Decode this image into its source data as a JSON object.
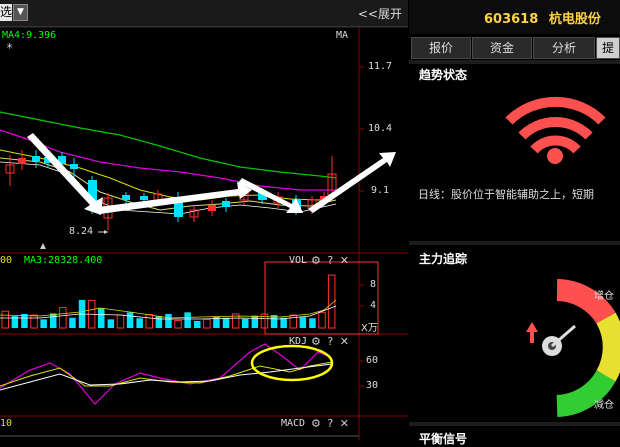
{
  "toolbar": {
    "select_label": "选",
    "expand_label": "<<展开"
  },
  "main_chart": {
    "indicator_name": "MA",
    "ma4_label": "MA4:9.396",
    "star": "*",
    "price_ticks": [
      "11.7",
      "10.4",
      "9.1"
    ],
    "low_price_label": "8.24",
    "colors": {
      "ma_yellow": "#e0e000",
      "ma_magenta": "#e000e0",
      "ma_green": "#00c800",
      "up": "#ff3030",
      "down": "#00e0ff"
    }
  },
  "volume_chart": {
    "left_fragment": "00",
    "ma3_label": "MA3:28328.400",
    "indicator_name": "VOL",
    "ticks": [
      "8",
      "4"
    ],
    "unit": "X万",
    "values": [
      3.1,
      2.2,
      2.6,
      2.4,
      1.6,
      2.7,
      3.8,
      1.9,
      5.2,
      5.1,
      3.6,
      1.6,
      2.4,
      2.9,
      1.8,
      2.5,
      2.2,
      2.6,
      1.4,
      2.9,
      1.3,
      1.6,
      2.1,
      1.9,
      2.6,
      1.7,
      2.3,
      2.6,
      2.4,
      1.9,
      2.4,
      2.0,
      1.8,
      2.9,
      9.8
    ]
  },
  "kdj_chart": {
    "indicator_name": "KDJ",
    "ticks": [
      "60",
      "30"
    ]
  },
  "macd_chart": {
    "left_fragment": "10",
    "indicator_name": "MACD"
  },
  "panel_icons": [
    "gear-icon",
    "question-icon",
    "close-icon"
  ],
  "sidebar": {
    "code": "603618",
    "name": "杭电股份",
    "tabs": [
      "报价",
      "资金",
      "分析",
      "提"
    ],
    "active_tab": 3,
    "trend": {
      "title": "趋势状态",
      "text": "日线：股价位于智能辅助之上，短期"
    },
    "tracking": {
      "title": "主力追踪",
      "increase_label": "增仓",
      "decrease_label": "减仓"
    },
    "bottom_title": "平衡信号"
  }
}
